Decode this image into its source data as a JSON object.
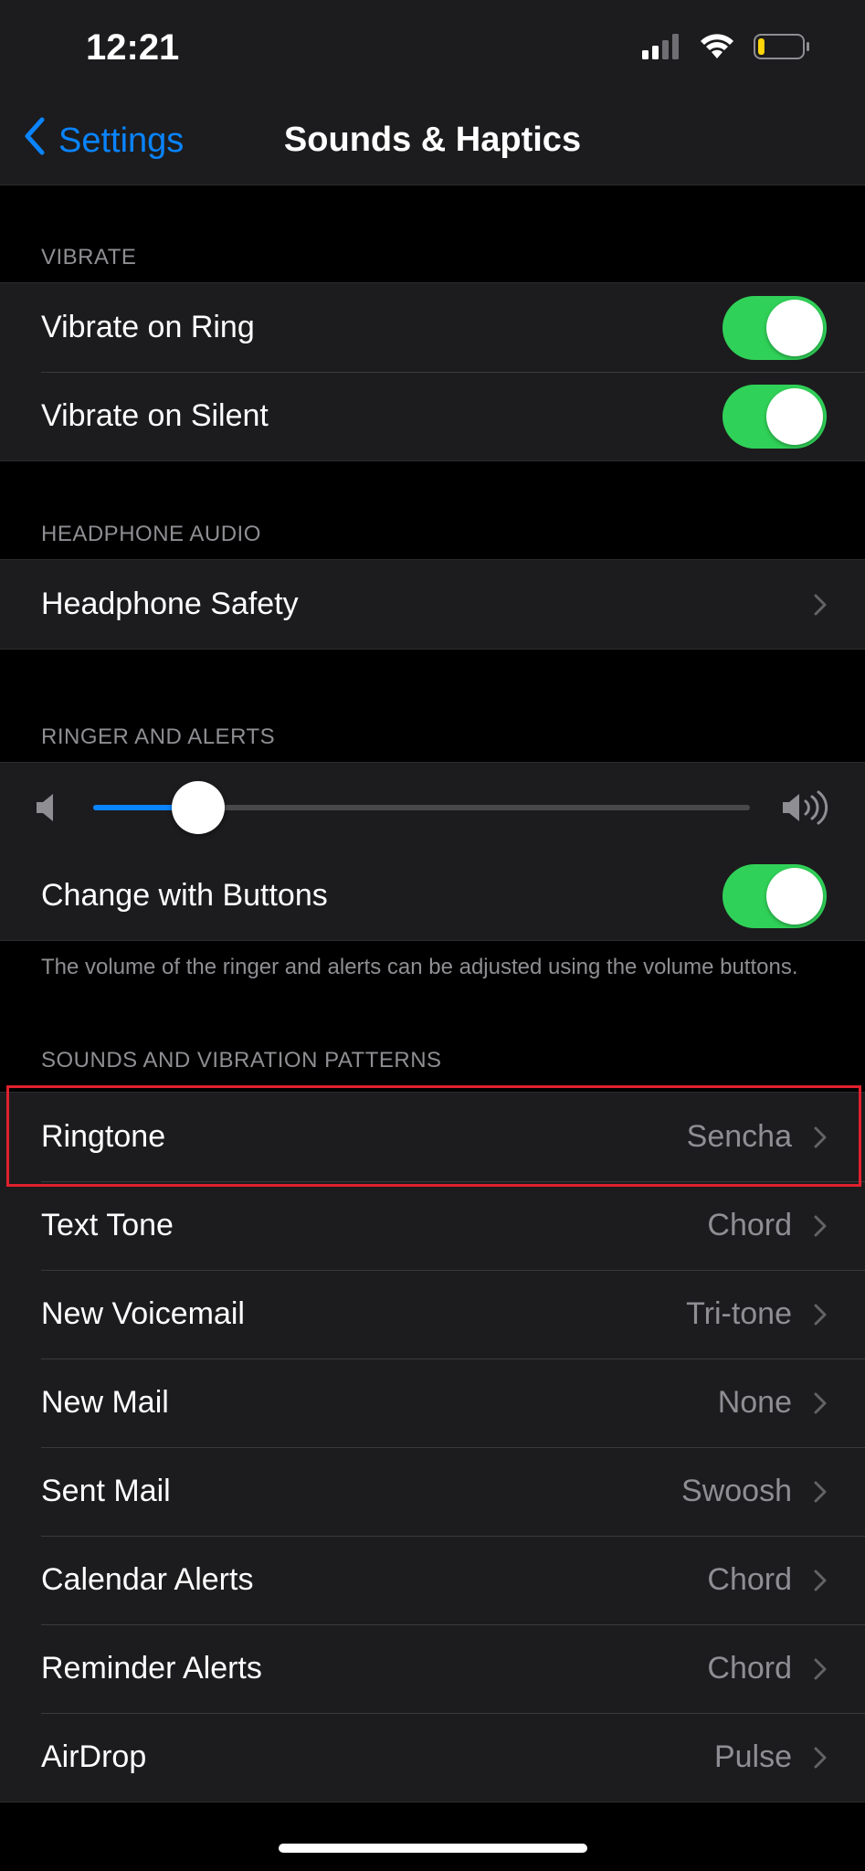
{
  "status_bar": {
    "time": "12:21",
    "icons": [
      "cellular-signal-icon",
      "wifi-icon",
      "battery-low-icon"
    ],
    "battery_level": 0.15
  },
  "nav": {
    "back_label": "Settings",
    "title": "Sounds & Haptics"
  },
  "vibrate": {
    "header": "VIBRATE",
    "rows": [
      {
        "label": "Vibrate on Ring",
        "on": true
      },
      {
        "label": "Vibrate on Silent",
        "on": true
      }
    ]
  },
  "headphone": {
    "header": "HEADPHONE AUDIO",
    "row_label": "Headphone Safety"
  },
  "ringer": {
    "header": "RINGER AND ALERTS",
    "volume_fraction": 0.16,
    "change_with_buttons_label": "Change with Buttons",
    "change_with_buttons_on": true,
    "note": "The volume of the ringer and alerts can be adjusted using the volume buttons."
  },
  "patterns": {
    "header": "SOUNDS AND VIBRATION PATTERNS",
    "rows": [
      {
        "label": "Ringtone",
        "value": "Sencha"
      },
      {
        "label": "Text Tone",
        "value": "Chord"
      },
      {
        "label": "New Voicemail",
        "value": "Tri-tone"
      },
      {
        "label": "New Mail",
        "value": "None"
      },
      {
        "label": "Sent Mail",
        "value": "Swoosh"
      },
      {
        "label": "Calendar Alerts",
        "value": "Chord"
      },
      {
        "label": "Reminder Alerts",
        "value": "Chord"
      },
      {
        "label": "AirDrop",
        "value": "Pulse"
      }
    ]
  },
  "colors": {
    "accent": "#0a84ff",
    "toggle_on": "#30d158",
    "highlight": "#e0202e",
    "battery_fill": "#ffd60a"
  }
}
